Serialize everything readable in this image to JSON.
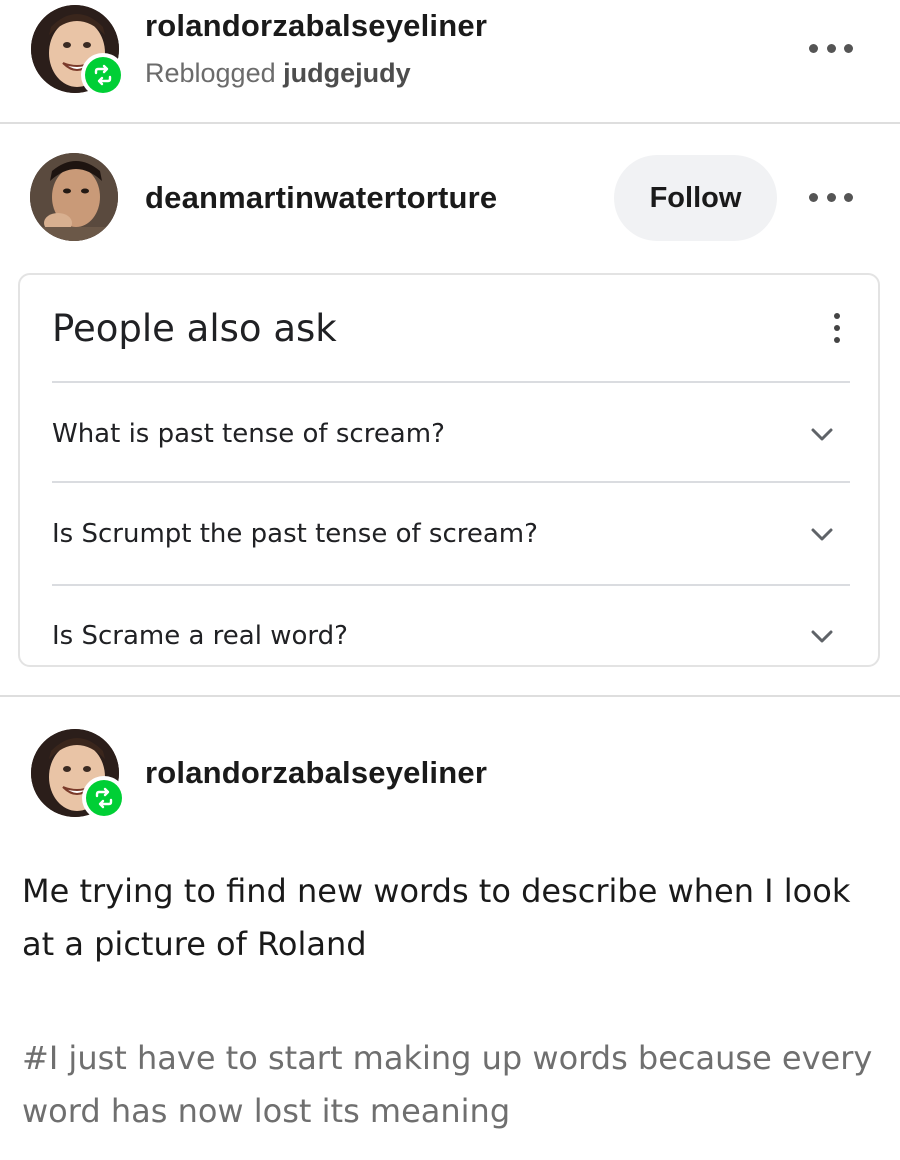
{
  "reblog_header": {
    "username": "rolandorzabalseyeliner",
    "reblogged_prefix": "Reblogged",
    "reblogged_from": "judgejudy",
    "more_icon": "more-horizontal-icon",
    "badge_icon": "reblog-icon"
  },
  "original_post": {
    "username": "deanmartinwatertorture",
    "follow_label": "Follow",
    "more_icon": "more-horizontal-icon"
  },
  "people_also_ask": {
    "title": "People also ask",
    "menu_icon": "more-vertical-icon",
    "questions": [
      "What is past tense of scream?",
      "Is Scrumpt the past tense of scream?",
      "Is Scrame a real word?"
    ],
    "expand_icon": "chevron-down-icon"
  },
  "reblog_comment": {
    "username": "rolandorzabalseyeliner",
    "badge_icon": "reblog-icon",
    "text": "Me trying to find new words to describe when I look at a picture of Roland",
    "tags": "#I just have to start making up words because every word has now lost its meaning"
  },
  "colors": {
    "reblog_green": "#00cf35",
    "follow_bg": "#f1f2f4",
    "divider": "#dedede",
    "tag_gray": "#6f6f6f"
  }
}
